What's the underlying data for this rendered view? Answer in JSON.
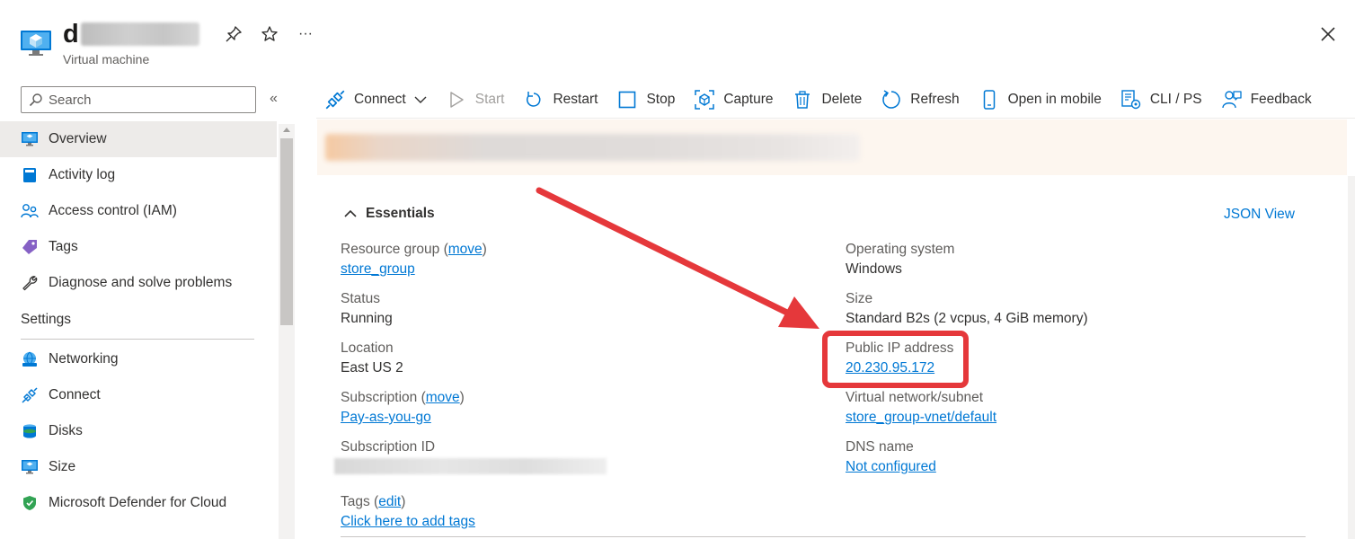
{
  "header": {
    "title_initial": "d",
    "subtitle": "Virtual machine",
    "icons": [
      "vm-logo-icon",
      "pin-icon",
      "star-icon",
      "more-icon",
      "close-icon"
    ],
    "more_label": "···"
  },
  "sidebar": {
    "search_placeholder": "Search",
    "collapse_label": "«",
    "items": [
      {
        "label": "Overview",
        "icon": "monitor-icon",
        "active": true
      },
      {
        "label": "Activity log",
        "icon": "book-icon"
      },
      {
        "label": "Access control (IAM)",
        "icon": "people-icon"
      },
      {
        "label": "Tags",
        "icon": "tag-icon"
      },
      {
        "label": "Diagnose and solve problems",
        "icon": "wrench-icon"
      }
    ],
    "section_settings": "Settings",
    "settings_items": [
      {
        "label": "Networking",
        "icon": "globe-icon"
      },
      {
        "label": "Connect",
        "icon": "plug-icon"
      },
      {
        "label": "Disks",
        "icon": "disk-icon"
      },
      {
        "label": "Size",
        "icon": "monitor-icon"
      },
      {
        "label": "Microsoft Defender for Cloud",
        "icon": "shield-icon"
      }
    ]
  },
  "toolbar": {
    "connect": "Connect",
    "start": "Start",
    "restart": "Restart",
    "stop": "Stop",
    "capture": "Capture",
    "delete": "Delete",
    "refresh": "Refresh",
    "open_mobile": "Open in mobile",
    "cli": "CLI / PS",
    "feedback": "Feedback"
  },
  "essentials": {
    "heading": "Essentials",
    "json_view": "JSON View",
    "left": {
      "resource_group_label": "Resource group",
      "move_link": "move",
      "resource_group_value": "store_group",
      "status_label": "Status",
      "status_value": "Running",
      "location_label": "Location",
      "location_value": "East US 2",
      "subscription_label": "Subscription",
      "subscription_value": "Pay-as-you-go",
      "subscription_id_label": "Subscription ID"
    },
    "right": {
      "os_label": "Operating system",
      "os_value": "Windows",
      "size_label": "Size",
      "size_value": "Standard B2s (2 vcpus, 4 GiB memory)",
      "public_ip_label": "Public IP address",
      "public_ip_value": "20.230.95.172",
      "vnet_label": "Virtual network/subnet",
      "vnet_value": "store_group-vnet/default",
      "dns_label": "DNS name",
      "dns_value": "Not configured"
    },
    "tags_label": "Tags",
    "tags_edit": "edit",
    "tags_add": "Click here to add tags"
  },
  "colors": {
    "accent": "#0078d4",
    "annotation": "#e5383b",
    "banner_bg": "#fdf6ef",
    "active_nav": "#edebe9"
  }
}
